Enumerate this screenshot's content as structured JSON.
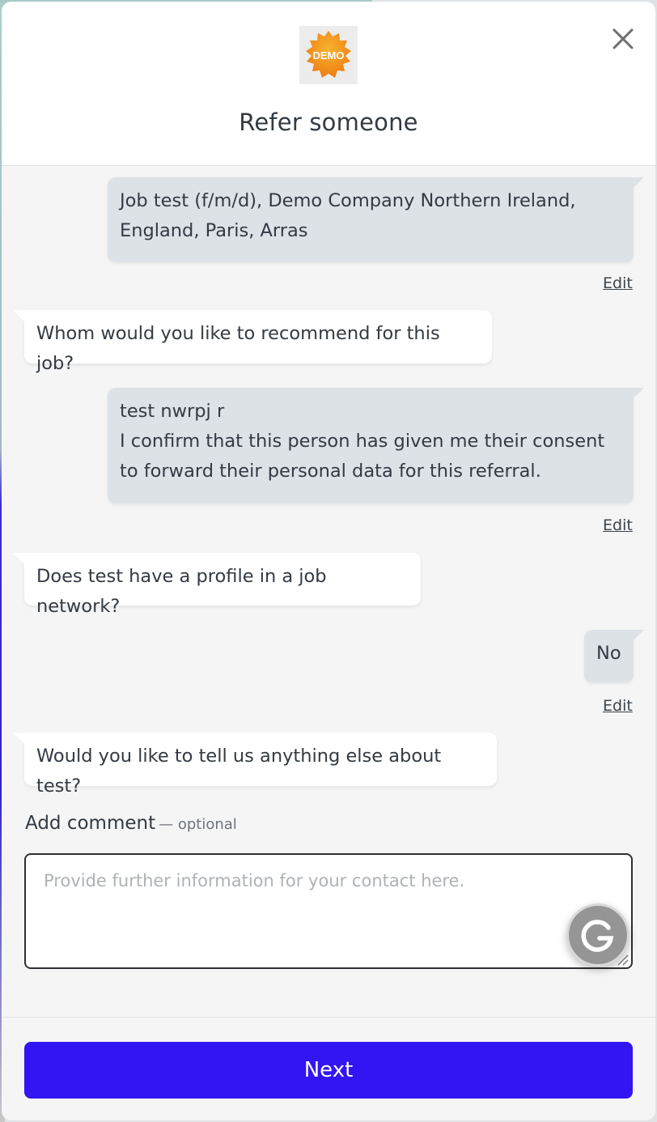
{
  "header": {
    "logo_text": "DEMO",
    "title": "Refer someone",
    "close_icon": "close-icon"
  },
  "messages": [
    {
      "role": "user",
      "text": "Job test (f/m/d), Demo Company Northern Ireland, England, Paris, Arras"
    },
    {
      "role": "bot",
      "text": "Whom would you like to recommend for this job?"
    },
    {
      "role": "user",
      "line1": "test nwrpj r",
      "line2": "I confirm that this person has given me their consent to forward their personal data for this referral."
    },
    {
      "role": "bot",
      "text": "Does test have a profile in a job network?"
    },
    {
      "role": "user",
      "text": "No"
    },
    {
      "role": "bot",
      "text": "Would you like to tell us anything else about test?"
    }
  ],
  "edit_label": "Edit",
  "comment": {
    "label": "Add comment",
    "optional": "— optional",
    "placeholder": "Provide further information for your contact here.",
    "value": ""
  },
  "footer": {
    "next_label": "Next"
  },
  "colors": {
    "primary_button": "#3314f2",
    "user_bubble": "#dde2e7",
    "bot_bubble": "#ffffff",
    "logo_badge": "#f29a18"
  }
}
